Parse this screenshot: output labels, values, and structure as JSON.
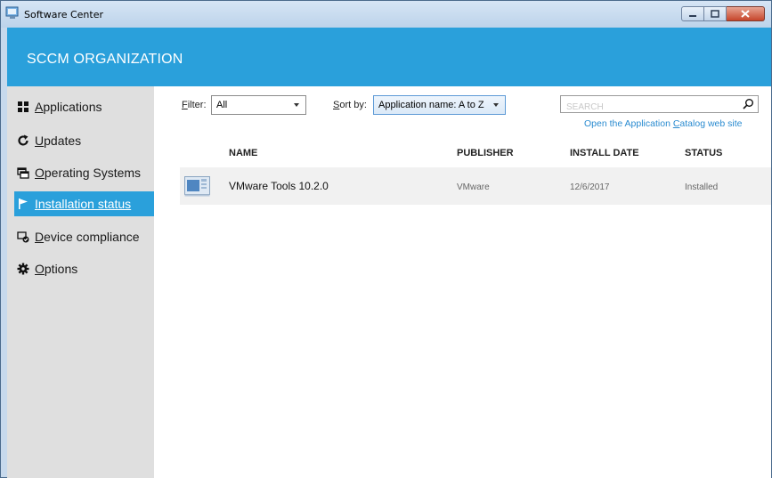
{
  "window": {
    "title": "Software Center",
    "icons": [
      "app-icon",
      "minimize-icon",
      "maximize-icon",
      "close-icon"
    ]
  },
  "header": {
    "org": "SCCM ORGANIZATION"
  },
  "sidebar": {
    "items": [
      {
        "key": "A",
        "rest": "pplications",
        "icon": "applications-icon"
      },
      {
        "key": "U",
        "rest": "pdates",
        "icon": "refresh-icon"
      },
      {
        "key": "O",
        "rest": "perating Systems",
        "icon": "windows-icon"
      },
      {
        "key": "I",
        "rest": "nstallation status",
        "icon": "flag-icon",
        "active": true
      },
      {
        "key": "D",
        "rest": "evice compliance",
        "icon": "device-compliance-icon"
      },
      {
        "key": "O",
        "rest": "ptions",
        "icon": "gear-icon"
      }
    ]
  },
  "toolbar": {
    "filter_key": "F",
    "filter_rest": "ilter:",
    "filter_value": "All",
    "sort_key": "S",
    "sort_rest": "ort by:",
    "sort_value": "Application name: A to Z"
  },
  "search": {
    "placeholder": "SEARCH"
  },
  "catalog_link": {
    "pre": "Open the Application ",
    "key": "C",
    "post": "atalog web site"
  },
  "table": {
    "headers": [
      "NAME",
      "PUBLISHER",
      "INSTALL DATE",
      "STATUS"
    ],
    "rows": [
      {
        "name": "VMware Tools 10.2.0",
        "publisher": "VMware",
        "install_date": "12/6/2017",
        "status": "Installed"
      }
    ]
  },
  "colors": {
    "accent": "#2aa0db",
    "sidebar_bg": "#dfdfdf",
    "row_bg": "#f1f1f1"
  }
}
